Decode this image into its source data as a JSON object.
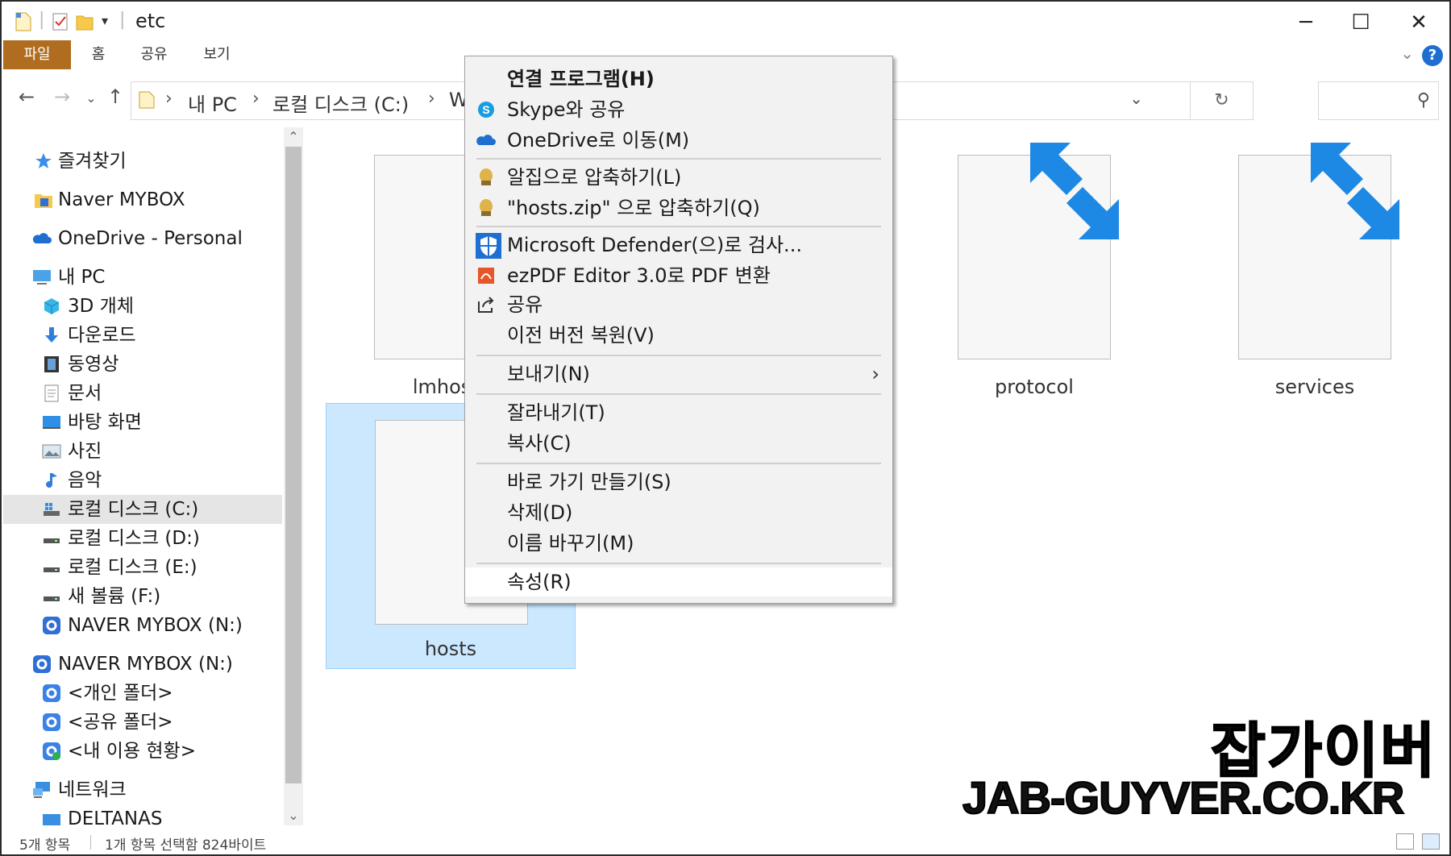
{
  "window": {
    "title": "etc",
    "minimize_glyph": "─",
    "maximize_glyph": "☐",
    "close_glyph": "✕"
  },
  "ribbon": {
    "tabs": [
      {
        "label": "파일"
      },
      {
        "label": "홈"
      },
      {
        "label": "공유"
      },
      {
        "label": "보기"
      }
    ],
    "help_glyph": "?",
    "collapse_glyph": "⌄"
  },
  "nav": {
    "back_glyph": "←",
    "forward_glyph": "→",
    "recent_glyph": "⌄",
    "up_glyph": "↑"
  },
  "address": {
    "crumbs": [
      "내 PC",
      "로컬 디스크 (C:)",
      "W"
    ],
    "separator": "›",
    "dropdown_glyph": "⌄",
    "refresh_glyph": "↻"
  },
  "search": {
    "icon": "search-icon",
    "glyph": "⚲"
  },
  "sidebar": {
    "items": [
      {
        "label": "즐겨찾기",
        "icon": "star-icon"
      },
      {
        "label": "Naver MYBOX",
        "icon": "mybox-folder-icon"
      },
      {
        "label": "OneDrive - Personal",
        "icon": "onedrive-cloud-icon"
      },
      {
        "label": "내 PC",
        "icon": "computer-icon"
      },
      {
        "label": "3D 개체",
        "icon": "3d-objects-icon"
      },
      {
        "label": "다운로드",
        "icon": "download-icon"
      },
      {
        "label": "동영상",
        "icon": "video-icon"
      },
      {
        "label": "문서",
        "icon": "document-icon"
      },
      {
        "label": "바탕 화면",
        "icon": "desktop-icon"
      },
      {
        "label": "사진",
        "icon": "pictures-icon"
      },
      {
        "label": "음악",
        "icon": "music-icon"
      },
      {
        "label": "로컬 디스크 (C:)",
        "icon": "windows-drive-icon"
      },
      {
        "label": "로컬 디스크 (D:)",
        "icon": "drive-icon"
      },
      {
        "label": "로컬 디스크 (E:)",
        "icon": "drive-icon"
      },
      {
        "label": "새 볼륨 (F:)",
        "icon": "drive-icon"
      },
      {
        "label": "NAVER MYBOX (N:)",
        "icon": "mybox-drive-icon"
      },
      {
        "label": "NAVER MYBOX (N:)",
        "icon": "mybox-drive-icon"
      },
      {
        "label": "<개인 폴더>",
        "icon": "personal-folder-icon"
      },
      {
        "label": "<공유 폴더>",
        "icon": "shared-folder-icon"
      },
      {
        "label": "<내 이용 현황>",
        "icon": "usage-icon"
      },
      {
        "label": "네트워크",
        "icon": "network-icon"
      },
      {
        "label": "DELTANAS",
        "icon": "nas-icon"
      }
    ],
    "scroll_up_glyph": "⌃",
    "scroll_down_glyph": "⌄"
  },
  "files": [
    {
      "name": "lmhosts"
    },
    {
      "name": "protocol"
    },
    {
      "name": "services"
    },
    {
      "name": "hosts"
    }
  ],
  "context_menu": {
    "items": [
      {
        "label": "연결 프로그램(H)",
        "icon": ""
      },
      {
        "label": "Skype와 공유",
        "icon": "skype-icon"
      },
      {
        "label": "OneDrive로 이동(M)",
        "icon": "onedrive-cloud-icon"
      },
      {
        "label": "알집으로 압축하기(L)",
        "icon": "alzip-icon"
      },
      {
        "label": "\"hosts.zip\" 으로 압축하기(Q)",
        "icon": "alzip-icon"
      },
      {
        "label": "Microsoft Defender(으)로 검사...",
        "icon": "defender-shield-icon"
      },
      {
        "label": "ezPDF Editor 3.0로 PDF 변환",
        "icon": "ezpdf-icon"
      },
      {
        "label": "공유",
        "icon": "share-icon"
      },
      {
        "label": "이전 버전 복원(V)",
        "icon": ""
      },
      {
        "label": "보내기(N)",
        "icon": ""
      },
      {
        "label": "잘라내기(T)",
        "icon": ""
      },
      {
        "label": "복사(C)",
        "icon": ""
      },
      {
        "label": "바로 가기 만들기(S)",
        "icon": ""
      },
      {
        "label": "삭제(D)",
        "icon": ""
      },
      {
        "label": "이름 바꾸기(M)",
        "icon": ""
      },
      {
        "label": "속성(R)",
        "icon": ""
      }
    ],
    "submenu_glyph": "›"
  },
  "statusbar": {
    "item_count": "5개 항목",
    "selection": "1개 항목 선택함 824바이트"
  },
  "watermark": {
    "korean": "잡가이버",
    "english": "JAB-GUYVER.CO.KR"
  },
  "colors": {
    "file_tab": "#b06d1f",
    "selection_fill": "#cce8ff",
    "shortcut_arrow": "#1e88e5",
    "help_badge": "#1f6fd1"
  }
}
